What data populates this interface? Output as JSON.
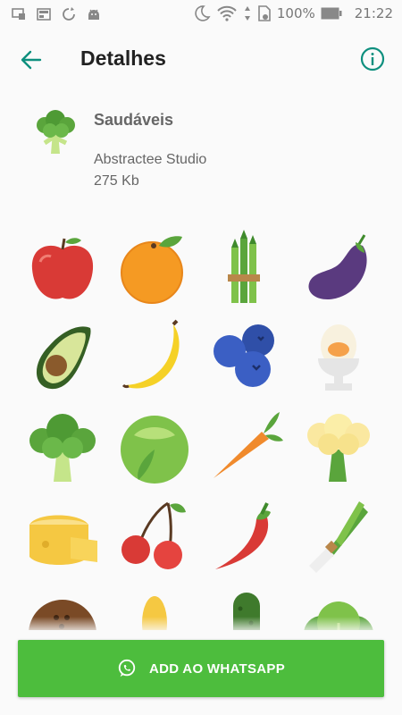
{
  "status_bar": {
    "battery": "100%",
    "time": "21:22"
  },
  "header": {
    "title": "Detalhes"
  },
  "pack": {
    "name": "Saudáveis",
    "publisher": "Abstractee Studio",
    "size": "275 Kb"
  },
  "stickers": [
    "apple",
    "orange",
    "asparagus",
    "eggplant",
    "avocado",
    "banana",
    "blueberries",
    "boiled-egg",
    "broccoli",
    "cabbage",
    "carrot",
    "cauliflower",
    "cheese",
    "cherries",
    "chili-pepper",
    "leek",
    "coconut",
    "corn",
    "cucumber",
    "lettuce"
  ],
  "action": {
    "add_label": "ADD AO WHATSAPP"
  },
  "colors": {
    "accent": "#0e8f7e",
    "button": "#4dbd3d"
  }
}
